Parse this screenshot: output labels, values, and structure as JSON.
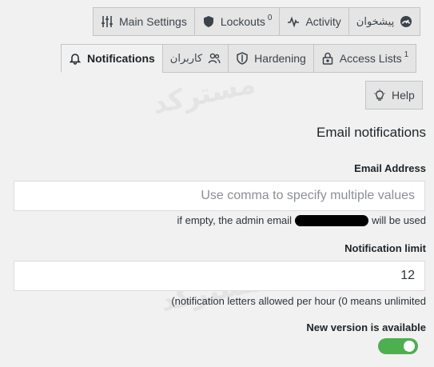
{
  "tabs_row1": [
    {
      "label": "Main Settings",
      "icon": "sliders-icon"
    },
    {
      "label": "Lockouts",
      "badge": "0",
      "icon": "shield-icon"
    },
    {
      "label": "Activity",
      "icon": "pulse-icon"
    },
    {
      "label": "پیشخوان",
      "icon": "dashboard-icon"
    }
  ],
  "tabs_row2": [
    {
      "label": "Notifications",
      "icon": "bell-icon",
      "active": true
    },
    {
      "label": "کاربران",
      "icon": "users-icon"
    },
    {
      "label": "Hardening",
      "icon": "shield-outline-icon"
    },
    {
      "label": "Access Lists",
      "badge": "1",
      "icon": "lock-icon"
    }
  ],
  "tabs_row3": [
    {
      "label": "Help",
      "icon": "lightbulb-icon"
    }
  ],
  "section": {
    "title": "Email notifications"
  },
  "email": {
    "label": "Email Address",
    "placeholder": "Use comma to specify multiple values",
    "hint_before": "if empty, the admin email",
    "hint_after": "will be used"
  },
  "limit": {
    "label": "Notification limit",
    "value": "12",
    "hint": "(notification letters allowed per hour (0 means unlimited"
  },
  "version": {
    "label": "New version is available",
    "enabled": true
  },
  "colors": {
    "toggle_on": "#4caf50",
    "background": "#f1f1f1",
    "tab_bg": "#e5e5e5"
  },
  "watermark": "مسترکد"
}
